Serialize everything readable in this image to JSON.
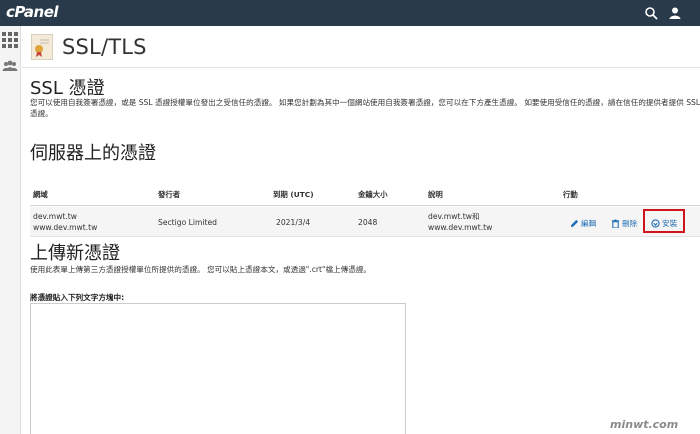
{
  "app": {
    "logo": "cPanel"
  },
  "header": {
    "title": "SSL/TLS"
  },
  "ssl_section": {
    "heading": "SSL 憑證",
    "description_line1": "您可以使用自我簽署憑證，或是 SSL 憑證授權單位發出之受信任的憑證。 如果您計劃為其中一個網站使用自我簽署憑證，您可以在下方產生憑證。 如要使用受信任的憑證，請在信任的提供者提供 SSL 憑",
    "description_line2": "憑證。"
  },
  "server_certs": {
    "heading": "伺服器上的憑證",
    "columns": [
      "網域",
      "發行者",
      "到期 (UTC)",
      "金鑰大小",
      "說明",
      "行動"
    ],
    "rows": [
      {
        "domain_line1": "dev.mwt.tw",
        "domain_line2": "www.dev.mwt.tw",
        "issuer": "Sectigo Limited",
        "expiry": "2021/3/4",
        "key_size": "2048",
        "desc_line1": "dev.mwt.tw和",
        "desc_line2": "www.dev.mwt.tw",
        "actions": {
          "edit": "編輯",
          "delete": "刪除",
          "install": "安裝"
        }
      }
    ]
  },
  "upload": {
    "heading": "上傳新憑證",
    "description": "使用此表單上傳第三方憑證授權單位所提供的憑證。 您可以貼上憑證本文，或透過\".crt\"檔上傳憑證。",
    "paste_label": "將憑證貼入下列文字方塊中:",
    "textarea_value": ""
  },
  "watermark": "minwt.com",
  "colors": {
    "topbar": "#293a4a",
    "link": "#1f6db5",
    "highlight": "#d0141c"
  }
}
